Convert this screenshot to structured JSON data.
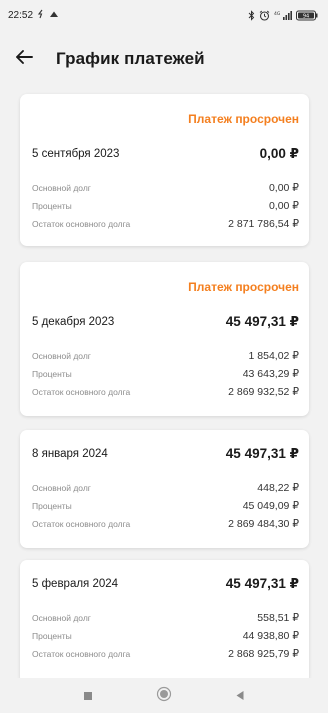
{
  "status_bar": {
    "time": "22:52",
    "battery": "94"
  },
  "header": {
    "title": "График платежей"
  },
  "payments": [
    {
      "status": "Платеж просрочен",
      "date": "5 сентября 2023",
      "total": "0,00 ₽",
      "rows": [
        {
          "label": "Основной долг",
          "value": "0,00 ₽"
        },
        {
          "label": "Проценты",
          "value": "0,00 ₽"
        },
        {
          "label": "Остаток основного долга",
          "value": "2 871 786,54 ₽"
        }
      ]
    },
    {
      "status": "Платеж просрочен",
      "date": "5 декабря 2023",
      "total": "45 497,31 ₽",
      "rows": [
        {
          "label": "Основной долг",
          "value": "1 854,02 ₽"
        },
        {
          "label": "Проценты",
          "value": "43 643,29 ₽"
        },
        {
          "label": "Остаток основного долга",
          "value": "2 869 932,52 ₽"
        }
      ]
    },
    {
      "status": "",
      "date": "8 января 2024",
      "total": "45 497,31 ₽",
      "rows": [
        {
          "label": "Основной долг",
          "value": "448,22 ₽"
        },
        {
          "label": "Проценты",
          "value": "45 049,09 ₽"
        },
        {
          "label": "Остаток основного долга",
          "value": "2 869 484,30 ₽"
        }
      ]
    },
    {
      "status": "",
      "date": "5 февраля 2024",
      "total": "45 497,31 ₽",
      "rows": [
        {
          "label": "Основной долг",
          "value": "558,51 ₽"
        },
        {
          "label": "Проценты",
          "value": "44 938,80 ₽"
        },
        {
          "label": "Остаток основного долга",
          "value": "2 868 925,79 ₽"
        }
      ]
    }
  ],
  "colors": {
    "accent_overdue": "#f47f1f",
    "background": "#f2f2f2",
    "card": "#ffffff"
  },
  "icons": {
    "back": "arrow-left-icon",
    "nav_recent": "square-icon",
    "nav_home": "circle-icon",
    "nav_back": "triangle-left-icon"
  }
}
